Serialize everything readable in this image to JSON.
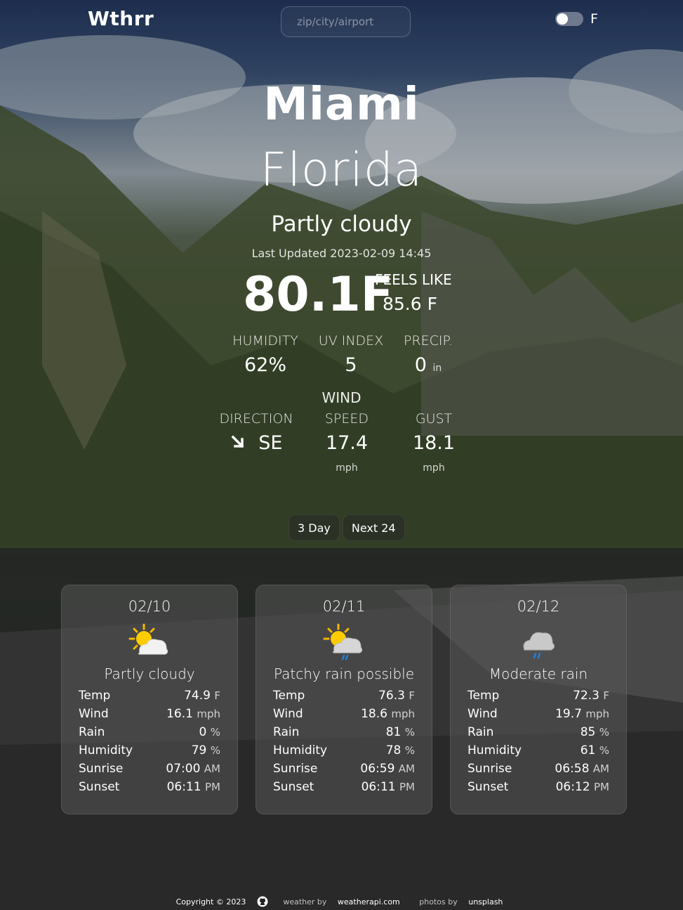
{
  "header": {
    "brand": "Wthrr",
    "search_placeholder": "zip/city/airport",
    "unit_label": "F"
  },
  "current": {
    "city": "Miami",
    "region": "Florida",
    "condition": "Partly cloudy",
    "last_updated": "Last Updated 2023-02-09 14:45",
    "temp": "80.1F",
    "feels_like_label": "FEELS LIKE",
    "feels_like_value": "85.6 F",
    "humidity_label": "HUMIDITY",
    "humidity_value": "62%",
    "uv_label": "UV INDEX",
    "uv_value": "5",
    "precip_label": "PRECIP.",
    "precip_value": "0",
    "precip_unit": "in",
    "wind_title": "WIND",
    "direction_label": "DIRECTION",
    "direction_value": "SE",
    "speed_label": "SPEED",
    "speed_value": "17.4",
    "speed_unit": "mph",
    "gust_label": "GUST",
    "gust_value": "18.1",
    "gust_unit": "mph"
  },
  "tabs": [
    "3 Day",
    "Next 24"
  ],
  "forecast": [
    {
      "date": "02/10",
      "condition": "Partly cloudy",
      "icon": "partly-cloudy-icon",
      "temp": "74.9",
      "temp_unit": "F",
      "wind": "16.1",
      "wind_unit": "mph",
      "rain": "0",
      "rain_unit": "%",
      "humidity": "79",
      "humidity_unit": "%",
      "sunrise": "07:00",
      "sunrise_unit": "AM",
      "sunset": "06:11",
      "sunset_unit": "PM"
    },
    {
      "date": "02/11",
      "condition": "Patchy rain possible",
      "icon": "sun-rain-cloud-icon",
      "temp": "76.3",
      "temp_unit": "F",
      "wind": "18.6",
      "wind_unit": "mph",
      "rain": "81",
      "rain_unit": "%",
      "humidity": "78",
      "humidity_unit": "%",
      "sunrise": "06:59",
      "sunrise_unit": "AM",
      "sunset": "06:11",
      "sunset_unit": "PM"
    },
    {
      "date": "02/12",
      "condition": "Moderate rain",
      "icon": "rain-cloud-icon",
      "temp": "72.3",
      "temp_unit": "F",
      "wind": "19.7",
      "wind_unit": "mph",
      "rain": "85",
      "rain_unit": "%",
      "humidity": "61",
      "humidity_unit": "%",
      "sunrise": "06:58",
      "sunrise_unit": "AM",
      "sunset": "06:12",
      "sunset_unit": "PM"
    }
  ],
  "row_labels": {
    "temp": "Temp",
    "wind": "Wind",
    "rain": "Rain",
    "humidity": "Humidity",
    "sunrise": "Sunrise",
    "sunset": "Sunset"
  },
  "footer": {
    "copyright": "Copyright © 2023",
    "weather_by": "weather by",
    "weather_source": "weatherapi.com",
    "photos_by": "photos by",
    "photos_source": "unsplash"
  }
}
